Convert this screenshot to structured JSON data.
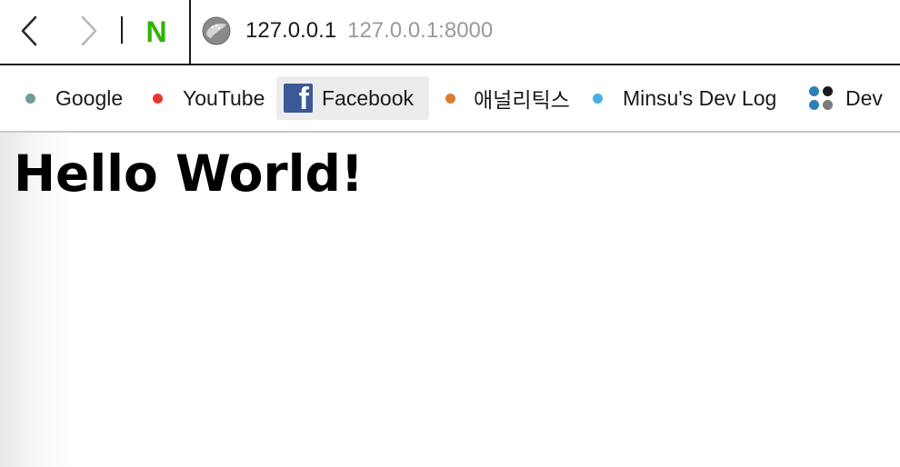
{
  "toolbar": {
    "back_icon": "chevron-left-icon",
    "forward_icon": "chevron-right-icon",
    "naver_label": "N",
    "naver_color": "#2db400",
    "site_icon": "globe-icon",
    "address_host": "127.0.0.1",
    "address_full": "127.0.0.1:8000"
  },
  "bookmarks": [
    {
      "label": "Google",
      "icon": "dot",
      "color": "#6a9e97"
    },
    {
      "label": "YouTube",
      "icon": "dot",
      "color": "#e8372e"
    },
    {
      "label": "Facebook",
      "icon": "facebook-logo",
      "color": "#3b5998",
      "active": true
    },
    {
      "label": "애널리틱스",
      "icon": "dot",
      "color": "#d97f38"
    },
    {
      "label": "Minsu's Dev Log",
      "icon": "dot",
      "color": "#4aaee6"
    },
    {
      "label": "Dev",
      "icon": "folder-grid",
      "colors": [
        "#2e7fb8",
        "#1a1a1a",
        "#2e7fb8",
        "#7a7a7a"
      ]
    }
  ],
  "page": {
    "heading": "Hello World!"
  }
}
